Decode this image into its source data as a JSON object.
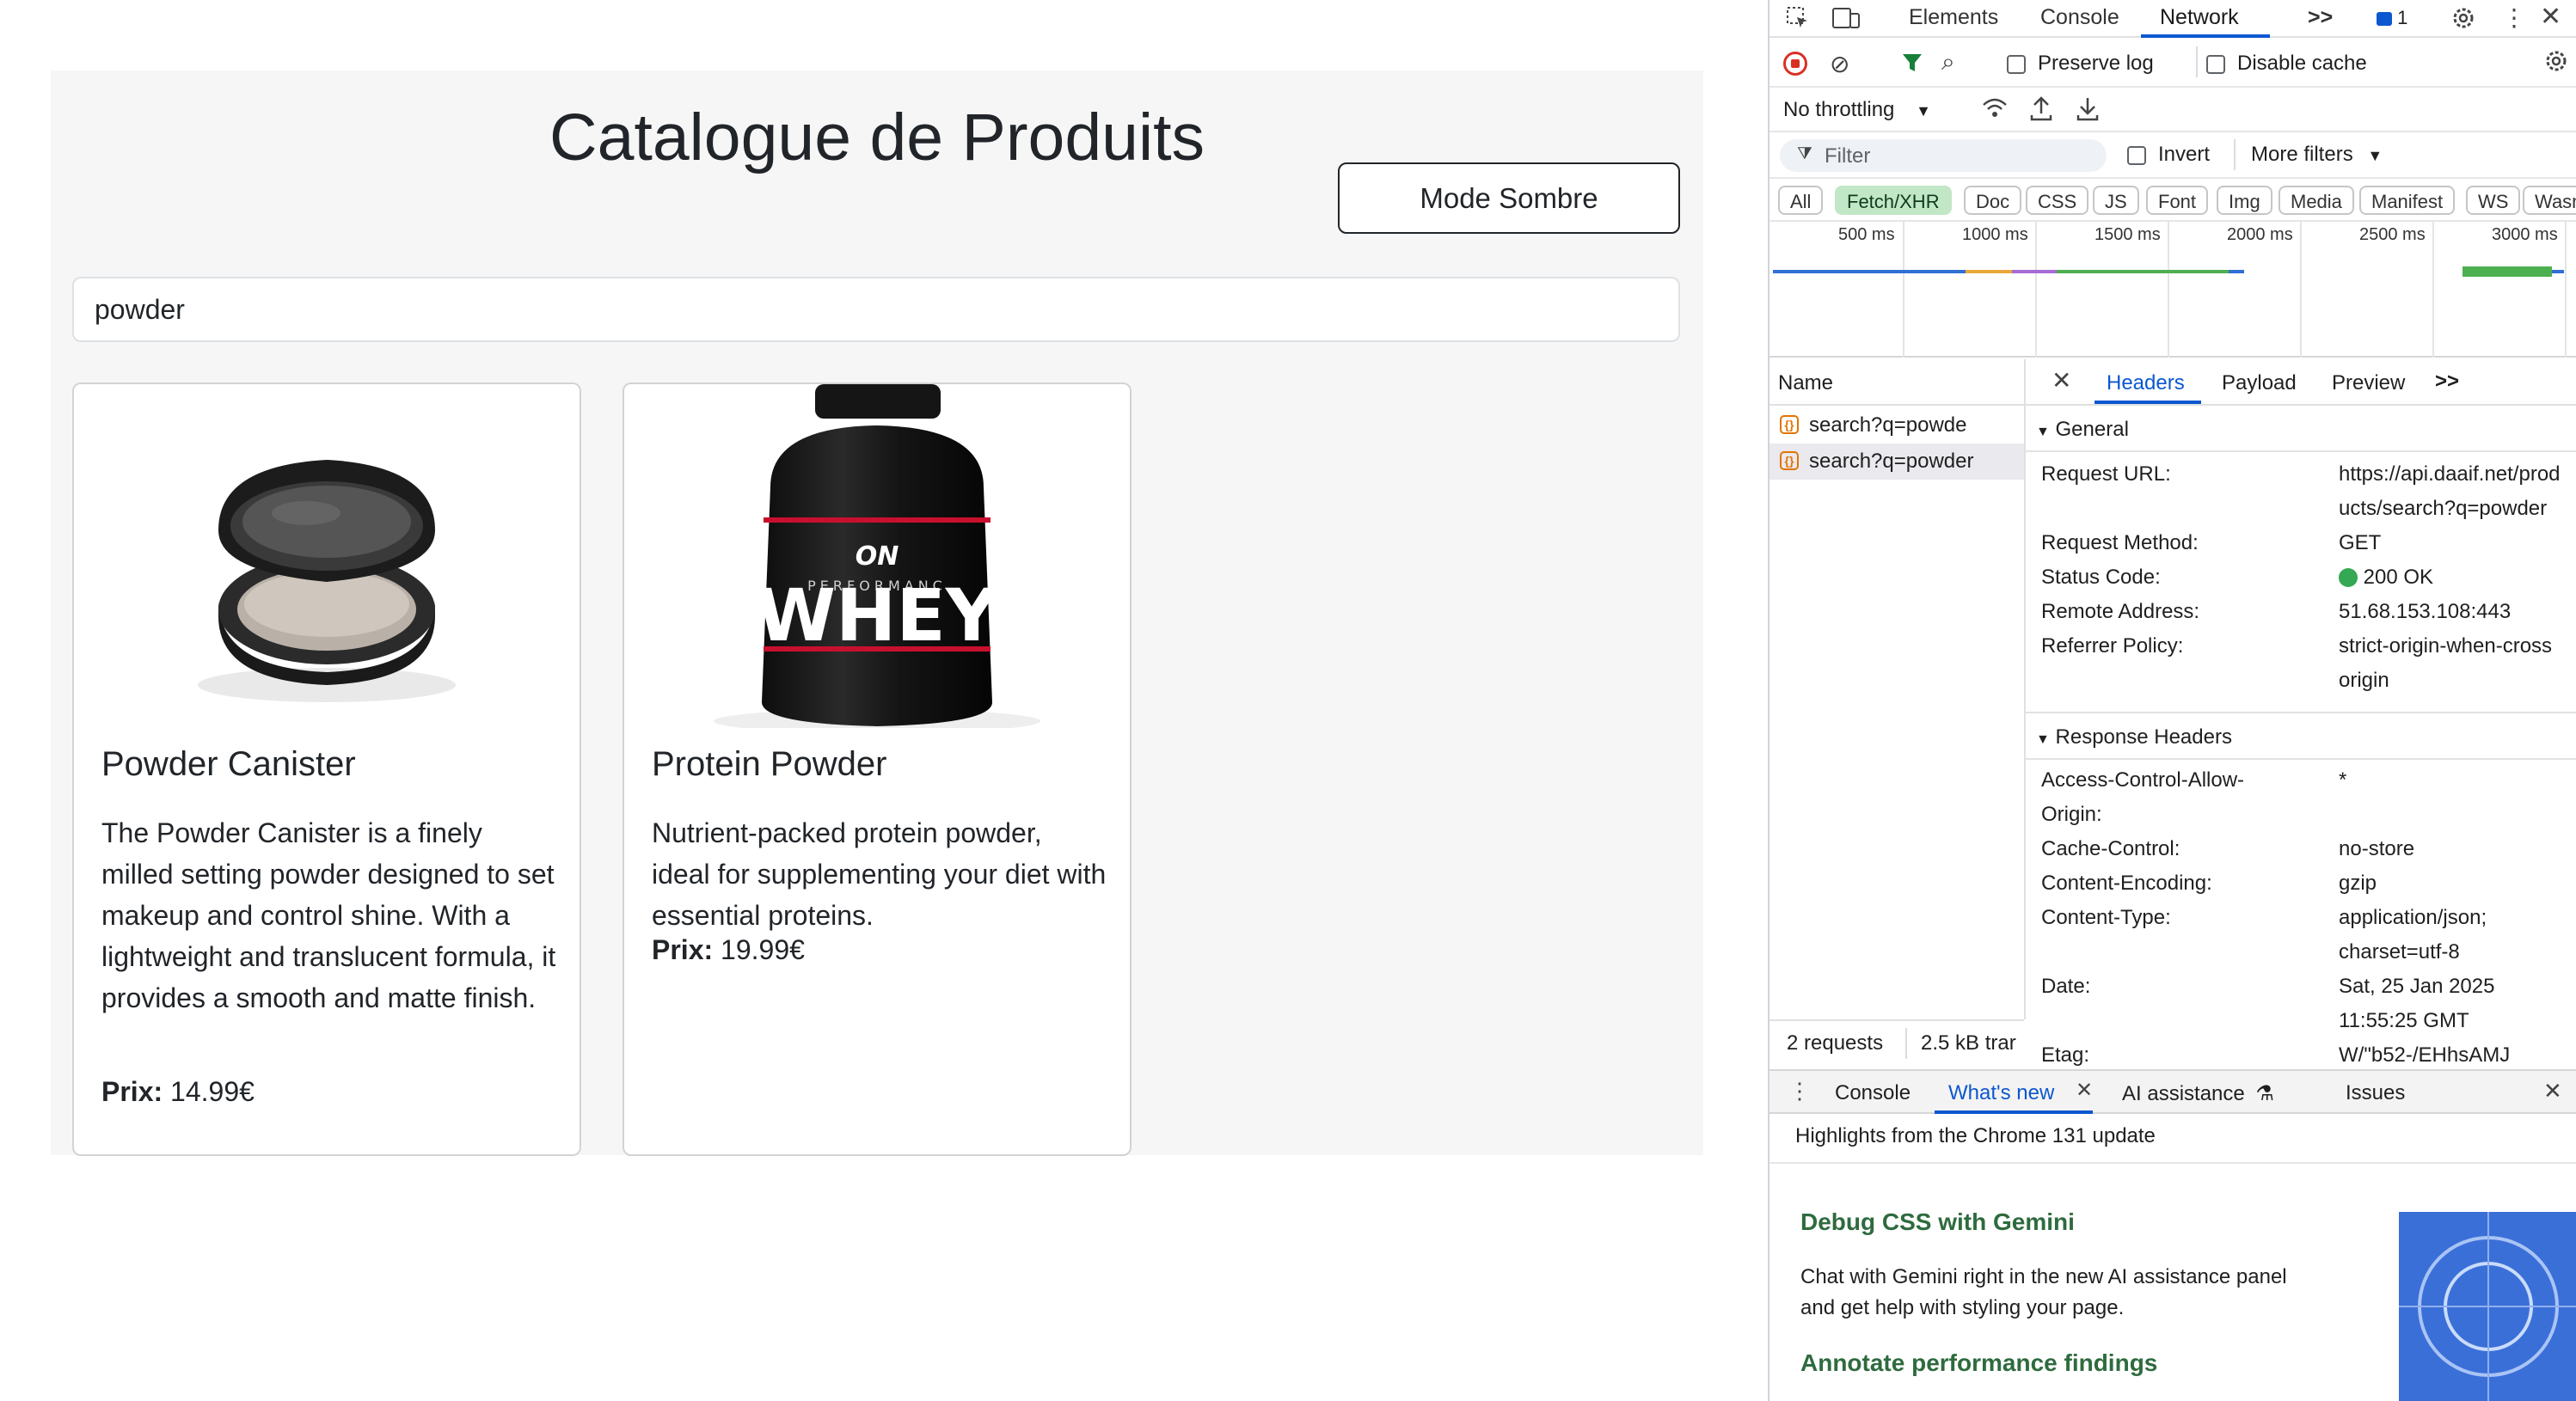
{
  "page": {
    "title": "Catalogue de Produits",
    "dark_mode_label": "Mode Sombre",
    "search_value": "powder",
    "products": [
      {
        "name": "Powder Canister",
        "description": "The Powder Canister is a finely milled setting powder designed to set makeup and control shine. With a lightweight and translucent formula, it provides a smooth and matte finish.",
        "price_label": "Prix:",
        "price": "14.99€"
      },
      {
        "name": "Protein Powder",
        "description": "Nutrient-packed protein powder, ideal for supplementing your diet with essential proteins.",
        "price_label": "Prix:",
        "price": "19.99€"
      }
    ],
    "whey_brand": "ON",
    "whey_sub": "PERFORMANC",
    "whey_word": "WHEY"
  },
  "devtools": {
    "tabs": [
      "Elements",
      "Console",
      "Network"
    ],
    "more_tabs": ">>",
    "issues_count": "1",
    "toolbar": {
      "preserve_log": "Preserve log",
      "disable_cache": "Disable cache",
      "throttling": "No throttling"
    },
    "filter": {
      "placeholder": "Filter",
      "invert": "Invert",
      "more_filters": "More filters"
    },
    "types": [
      "All",
      "Fetch/XHR",
      "Doc",
      "CSS",
      "JS",
      "Font",
      "Img",
      "Media",
      "Manifest",
      "WS",
      "Wasm"
    ],
    "timeline_labels": [
      "500 ms",
      "1000 ms",
      "1500 ms",
      "2000 ms",
      "2500 ms",
      "3000 ms"
    ],
    "name_header": "Name",
    "requests": [
      "search?q=powde",
      "search?q=powder"
    ],
    "detail_tabs": [
      "Headers",
      "Payload",
      "Preview"
    ],
    "general": {
      "title": "General",
      "request_url_key": "Request URL:",
      "request_url_val_1": "https://api.daaif.net/prod",
      "request_url_val_2": "ucts/search?q=powder",
      "method_key": "Request Method:",
      "method_val": "GET",
      "status_key": "Status Code:",
      "status_val": "200 OK",
      "remote_key": "Remote Address:",
      "remote_val": "51.68.153.108:443",
      "referrer_key": "Referrer Policy:",
      "referrer_val_1": "strict-origin-when-cross",
      "referrer_val_2": "origin"
    },
    "response": {
      "title": "Response Headers",
      "acao_key_1": "Access-Control-Allow-",
      "acao_key_2": "Origin:",
      "acao_val": "*",
      "cache_key": "Cache-Control:",
      "cache_val": "no-store",
      "enc_key": "Content-Encoding:",
      "enc_val": "gzip",
      "ctype_key": "Content-Type:",
      "ctype_val_1": "application/json;",
      "ctype_val_2": "charset=utf-8",
      "date_key": "Date:",
      "date_val_1": "Sat, 25 Jan 2025",
      "date_val_2": "11:55:25 GMT",
      "etag_key": "Etag:",
      "etag_val": "W/\"b52-/EHhsAMJ"
    },
    "status": {
      "requests": "2 requests",
      "transferred": "2.5 kB trar"
    },
    "drawer": {
      "tabs": [
        "Console",
        "What's new",
        "AI assistance",
        "Issues"
      ],
      "highlights": "Highlights from the Chrome 131 update",
      "heading1": "Debug CSS with Gemini",
      "body1_line1": "Chat with Gemini right in the new AI assistance panel",
      "body1_line2": "and get help with styling your page.",
      "heading2": "Annotate performance findings"
    },
    "colors": {
      "accent": "#0b57d0",
      "fetch_active": "#c2e7c6",
      "status_ok": "#34a853",
      "record": "#d93025",
      "drawer_heading": "#2e6b3e"
    }
  }
}
